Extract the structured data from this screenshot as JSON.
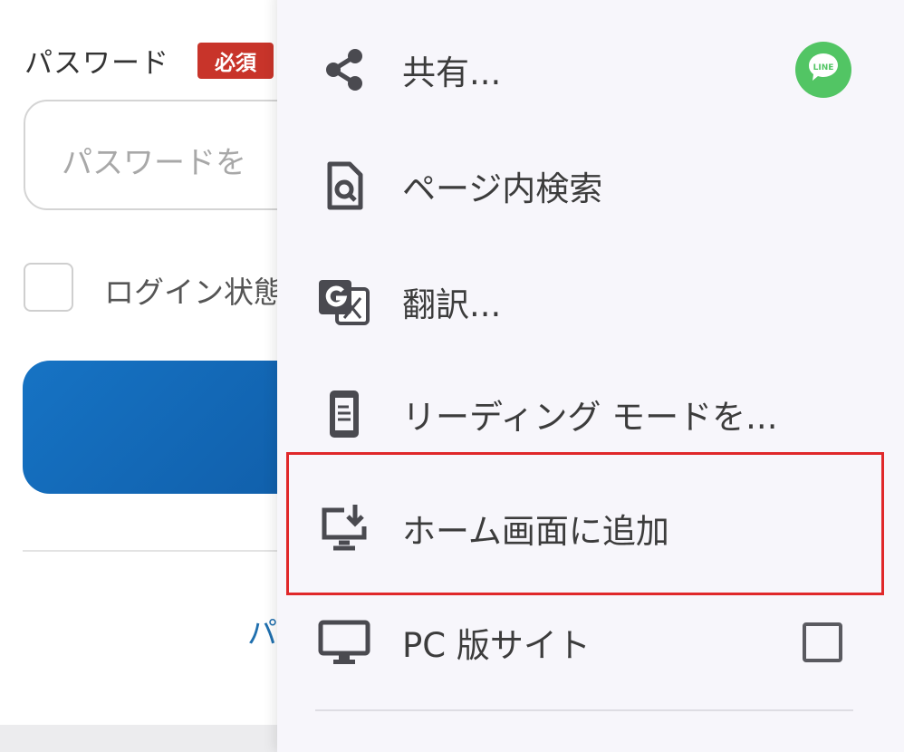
{
  "login_form": {
    "password_label": "パスワード",
    "required_badge": "必須",
    "password_placeholder": "パスワードを",
    "remember_label": "ログイン状態",
    "bottom_link": "パ"
  },
  "menu": {
    "items": [
      {
        "label": "共有...",
        "icon": "share-icon"
      },
      {
        "label": "ページ内検索",
        "icon": "find-in-page-icon"
      },
      {
        "label": "翻訳...",
        "icon": "translate-icon"
      },
      {
        "label": "リーディング モードを...",
        "icon": "reading-mode-icon"
      },
      {
        "label": "ホーム画面に追加",
        "icon": "add-to-home-screen-icon"
      },
      {
        "label": "PC 版サイト",
        "icon": "desktop-icon"
      }
    ],
    "line_badge_text": "LINE",
    "desktop_site_checked": false
  },
  "colors": {
    "highlight": "#e0282a",
    "required_badge": "#c8342a",
    "login_button": "#1673c4",
    "line_green": "#52c564"
  }
}
